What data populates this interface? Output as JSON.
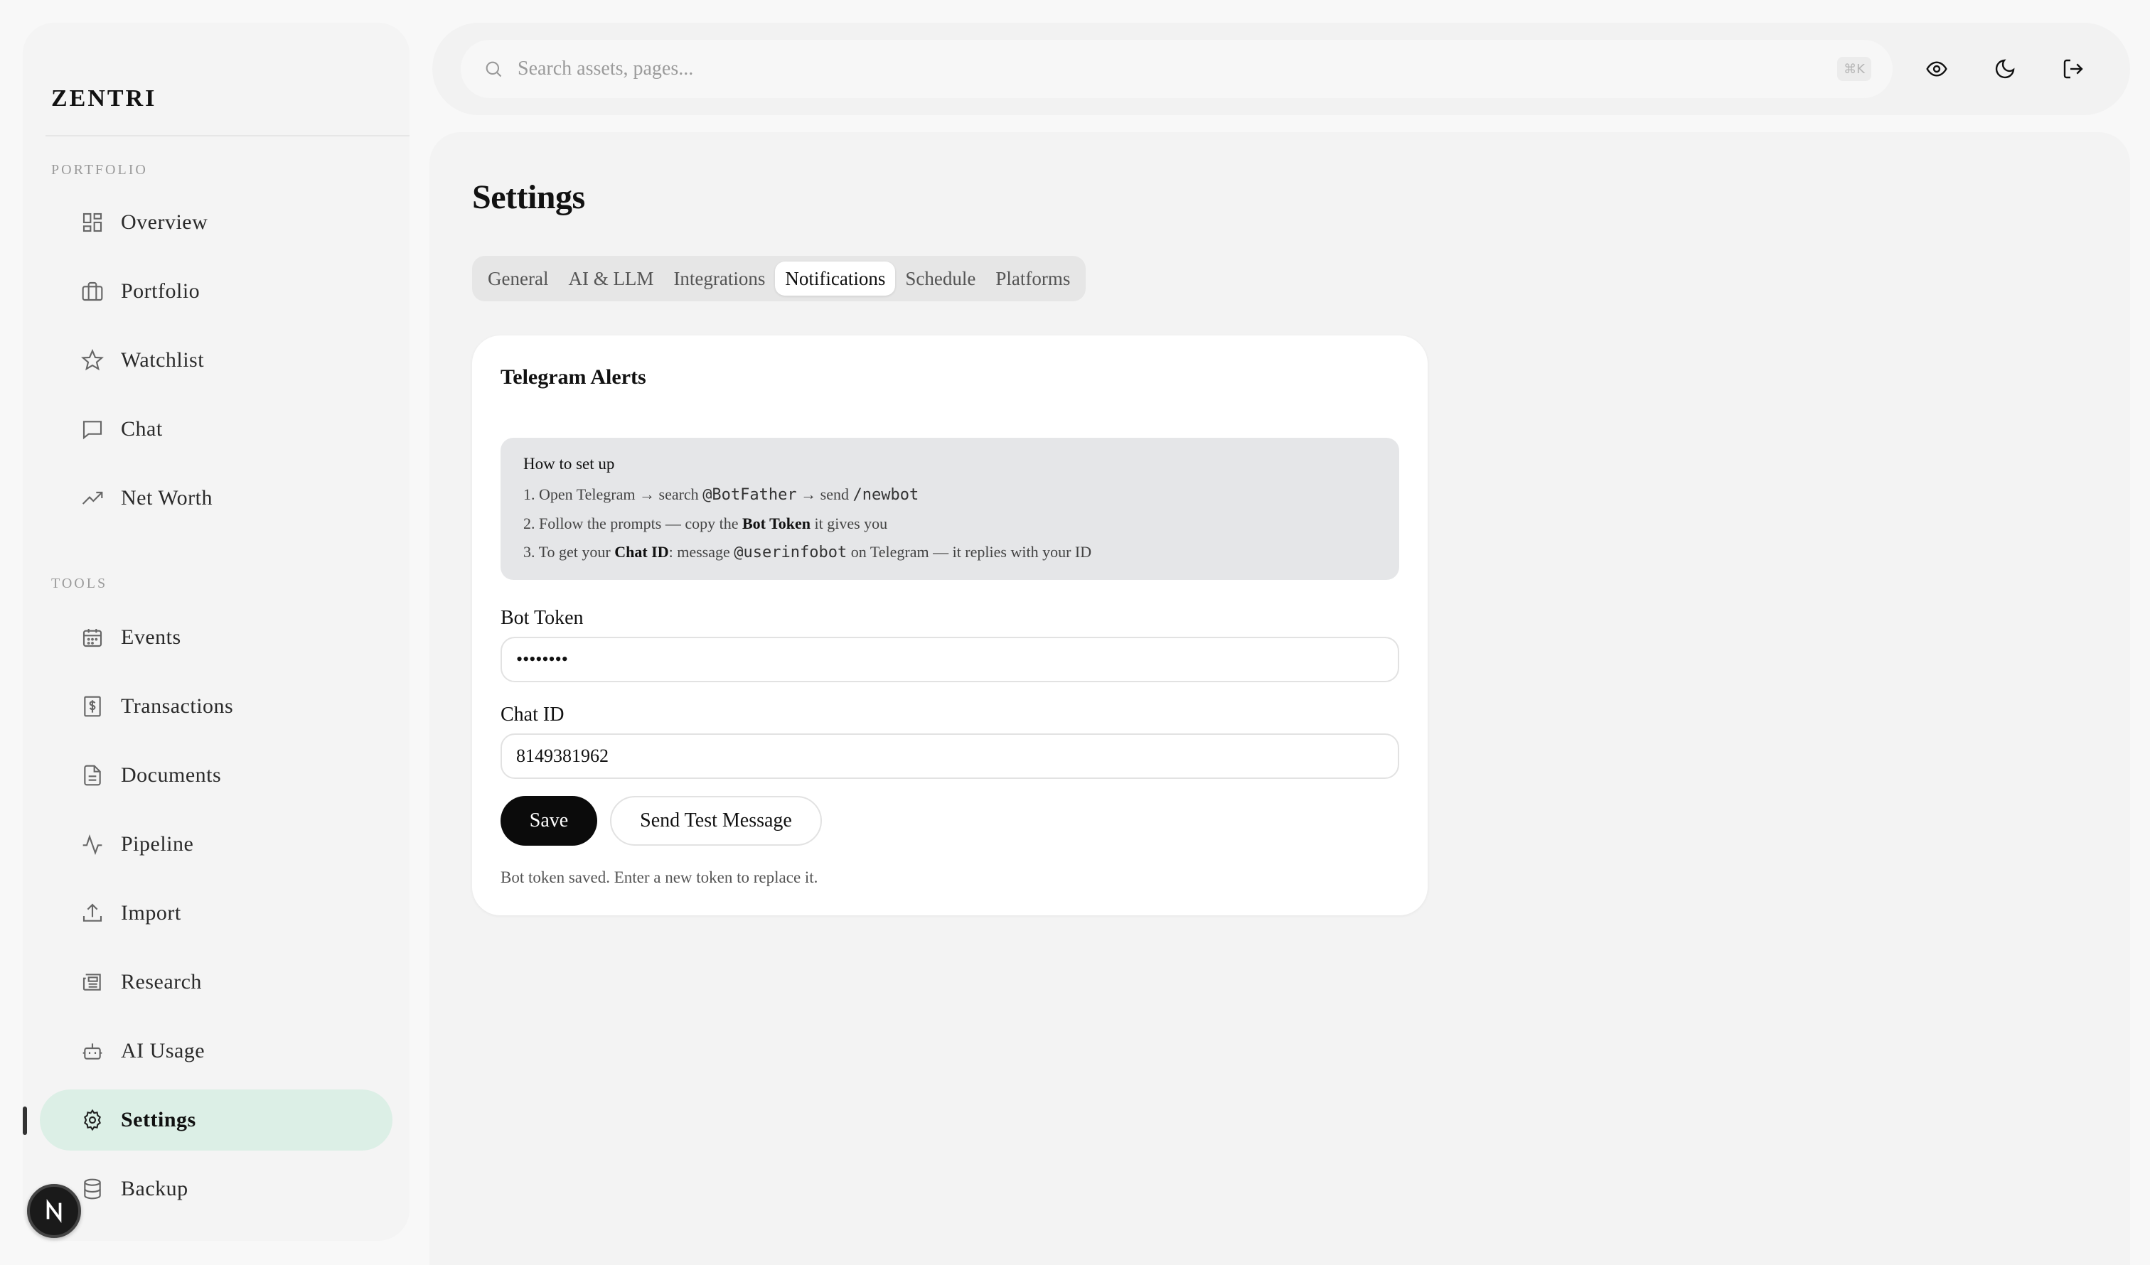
{
  "brand": "ZENTRI",
  "sidebar": {
    "sections": [
      {
        "label": "PORTFOLIO",
        "items": [
          {
            "label": "Overview",
            "icon": "grid-icon"
          },
          {
            "label": "Portfolio",
            "icon": "briefcase-icon"
          },
          {
            "label": "Watchlist",
            "icon": "star-icon"
          },
          {
            "label": "Chat",
            "icon": "chat-icon"
          },
          {
            "label": "Net Worth",
            "icon": "trending-up-icon"
          }
        ]
      },
      {
        "label": "TOOLS",
        "items": [
          {
            "label": "Events",
            "icon": "calendar-icon"
          },
          {
            "label": "Transactions",
            "icon": "receipt-icon"
          },
          {
            "label": "Documents",
            "icon": "document-icon"
          },
          {
            "label": "Pipeline",
            "icon": "pulse-icon"
          },
          {
            "label": "Import",
            "icon": "upload-icon"
          },
          {
            "label": "Research",
            "icon": "newspaper-icon"
          },
          {
            "label": "AI Usage",
            "icon": "bot-icon"
          },
          {
            "label": "Settings",
            "icon": "gear-icon",
            "active": true
          },
          {
            "label": "Backup",
            "icon": "database-icon"
          }
        ]
      }
    ],
    "avatar_letter": "N"
  },
  "topbar": {
    "search_placeholder": "Search assets, pages...",
    "search_shortcut": "⌘K"
  },
  "page": {
    "title": "Settings",
    "tabs": [
      "General",
      "AI & LLM",
      "Integrations",
      "Notifications",
      "Schedule",
      "Platforms"
    ],
    "active_tab": "Notifications"
  },
  "telegram": {
    "title": "Telegram Alerts",
    "howto_title": "How to set up",
    "step1": {
      "a": "1. Open Telegram → search ",
      "b": "@BotFather",
      "c": " → send ",
      "d": "/newbot"
    },
    "step2": {
      "a": "2. Follow the prompts — copy the ",
      "b": "Bot Token",
      "c": " it gives you"
    },
    "step3": {
      "a": "3. To get your ",
      "b": "Chat ID",
      "c": ": message ",
      "d": "@userinfobot",
      "e": " on Telegram — it replies with your ID"
    },
    "bot_token_label": "Bot Token",
    "bot_token_value": "••••••••",
    "chat_id_label": "Chat ID",
    "chat_id_value": "8149381962",
    "save_label": "Save",
    "test_label": "Send Test Message",
    "status": "Bot token saved. Enter a new token to replace it."
  }
}
